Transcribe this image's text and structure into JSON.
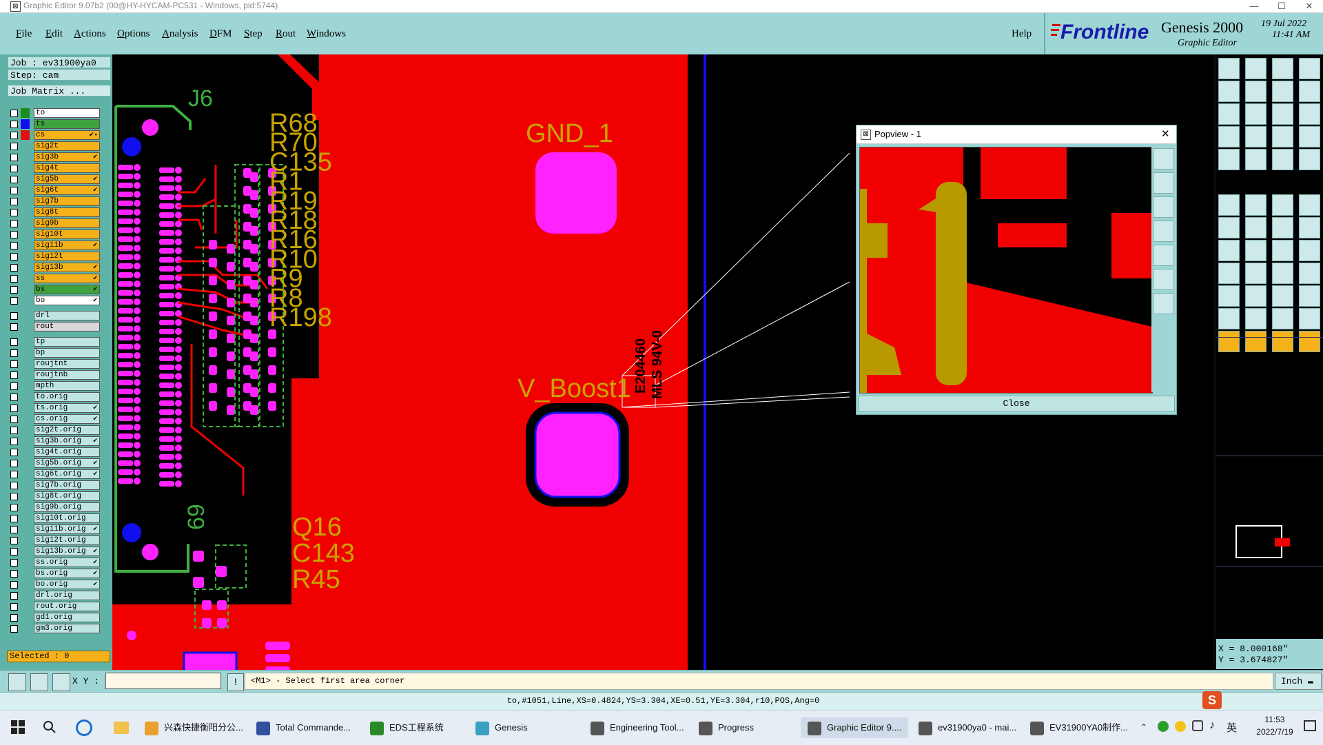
{
  "window": {
    "title": "Graphic Editor 9.07b2 (00@HY-HYCAM-PC531 - Windows, pid:5744)",
    "minimize": "—",
    "maximize": "☐",
    "close": "✕"
  },
  "menu": [
    {
      "key": "F",
      "rest": "ile"
    },
    {
      "key": "E",
      "rest": "dit"
    },
    {
      "key": "A",
      "rest": "ctions"
    },
    {
      "key": "O",
      "rest": "ptions"
    },
    {
      "key": "A",
      "rest": "nalysis"
    },
    {
      "key": "D",
      "rest": "FM"
    },
    {
      "key": "S",
      "rest": "tep"
    },
    {
      "key": "R",
      "rest": "out"
    },
    {
      "key": "W",
      "rest": "indows"
    }
  ],
  "help": "Help",
  "brand": {
    "logo": "Frontline",
    "product": "Genesis 2000",
    "subtitle": "Graphic Editor",
    "date": "19 Jul 2022",
    "time": "11:41 AM"
  },
  "left": {
    "job": "Job : ev31900ya0",
    "step": "Step: cam",
    "matrix": "Job Matrix ...",
    "selected": "Selected : 0",
    "layers": [
      {
        "name": "to",
        "color": "#1a8c1a",
        "bg": "#ffffff",
        "flag": ""
      },
      {
        "name": "ts",
        "color": "#1010ee",
        "bg": "#3fa23f",
        "flag": ""
      },
      {
        "name": "cs",
        "color": "#e01010",
        "bg": "#f5b11a",
        "flag": "✔▪"
      },
      {
        "name": "sig2t",
        "color": "",
        "bg": "#f5b11a",
        "flag": ""
      },
      {
        "name": "sig3b",
        "color": "",
        "bg": "#f5b11a",
        "flag": "✔"
      },
      {
        "name": "sig4t",
        "color": "",
        "bg": "#f5b11a",
        "flag": ""
      },
      {
        "name": "sig5b",
        "color": "",
        "bg": "#f5b11a",
        "flag": "✔"
      },
      {
        "name": "sig6t",
        "color": "",
        "bg": "#f5b11a",
        "flag": "✔"
      },
      {
        "name": "sig7b",
        "color": "",
        "bg": "#f5b11a",
        "flag": ""
      },
      {
        "name": "sig8t",
        "color": "",
        "bg": "#f5b11a",
        "flag": ""
      },
      {
        "name": "sig9b",
        "color": "",
        "bg": "#f5b11a",
        "flag": ""
      },
      {
        "name": "sig10t",
        "color": "",
        "bg": "#f5b11a",
        "flag": ""
      },
      {
        "name": "sig11b",
        "color": "",
        "bg": "#f5b11a",
        "flag": "✔"
      },
      {
        "name": "sig12t",
        "color": "",
        "bg": "#f5b11a",
        "flag": ""
      },
      {
        "name": "sig13b",
        "color": "",
        "bg": "#f5b11a",
        "flag": "✔"
      },
      {
        "name": "ss",
        "color": "",
        "bg": "#f5b11a",
        "flag": "✔"
      },
      {
        "name": "bs",
        "color": "",
        "bg": "#3fa23f",
        "flag": "✔"
      },
      {
        "name": "bo",
        "color": "",
        "bg": "#ffffff",
        "flag": "✔"
      }
    ],
    "layers2": [
      {
        "name": "drl",
        "bg": "#bfe5e3"
      },
      {
        "name": "rout",
        "bg": "#d8d8d8"
      }
    ],
    "layers3": [
      {
        "name": "tp",
        "flag": ""
      },
      {
        "name": "bp",
        "flag": ""
      },
      {
        "name": "roujtnt",
        "flag": ""
      },
      {
        "name": "roujtnb",
        "flag": ""
      },
      {
        "name": "mpth",
        "flag": ""
      },
      {
        "name": "to.orig",
        "flag": ""
      },
      {
        "name": "ts.orig",
        "flag": "✔"
      },
      {
        "name": "cs.orig",
        "flag": "✔"
      },
      {
        "name": "sig2t.orig",
        "flag": ""
      },
      {
        "name": "sig3b.orig",
        "flag": "✔"
      },
      {
        "name": "sig4t.orig",
        "flag": ""
      },
      {
        "name": "sig5b.orig",
        "flag": "✔"
      },
      {
        "name": "sig6t.orig",
        "flag": "✔"
      },
      {
        "name": "sig7b.orig",
        "flag": ""
      },
      {
        "name": "sig8t.orig",
        "flag": ""
      },
      {
        "name": "sig9b.orig",
        "flag": ""
      },
      {
        "name": "sig10t.orig",
        "flag": ""
      },
      {
        "name": "sig11b.orig",
        "flag": "✔"
      },
      {
        "name": "sig12t.orig",
        "flag": ""
      },
      {
        "name": "sig13b.orig",
        "flag": "✔"
      },
      {
        "name": "ss.orig",
        "flag": "✔"
      },
      {
        "name": "bs.orig",
        "flag": "✔"
      },
      {
        "name": "bo.orig",
        "flag": "✔"
      },
      {
        "name": "drl.orig",
        "flag": ""
      },
      {
        "name": "rout.orig",
        "flag": ""
      },
      {
        "name": "gd1.orig",
        "flag": ""
      },
      {
        "name": "gm3.orig",
        "flag": ""
      }
    ]
  },
  "canvas": {
    "labels": {
      "j6": "J6",
      "gnd": "GND_1",
      "vboost": "V_Boost1",
      "q16": "Q16",
      "c143": "C143",
      "r45": "R45",
      "n69": "69",
      "refs": [
        "R68",
        "R70",
        "C135",
        "R1",
        "R19",
        "R18",
        "R16",
        "R10",
        "R9",
        "R8",
        "R198"
      ],
      "vtext1": "E204460",
      "vtext2": "MLS 94V-0"
    }
  },
  "popview": {
    "title": "Popview - 1",
    "close_label": "Close",
    "close_x": "✕"
  },
  "coords": {
    "x": "X = 8.000168\"",
    "y": "Y = 3.674827\""
  },
  "cmd": {
    "xy_label": "X Y :",
    "xy_value": "",
    "prompt": "<M1> - Select first area corner",
    "units": "Inch"
  },
  "status": "to,#1051,Line,XS=0.4824,YS=3.304,XE=0.51,YE=3.304,r10,POS,Ang=0",
  "taskbar": {
    "items": [
      "兴森快捷衡阳分公...",
      "Total Commande...",
      "EDS工程系统",
      "Genesis",
      "Engineering Tool...",
      "Progress",
      "Graphic Editor 9....",
      "ev31900ya0 - mai...",
      "EV31900YA0制作..."
    ],
    "ime": "英",
    "time": "11:53",
    "date": "2022/7/19"
  }
}
